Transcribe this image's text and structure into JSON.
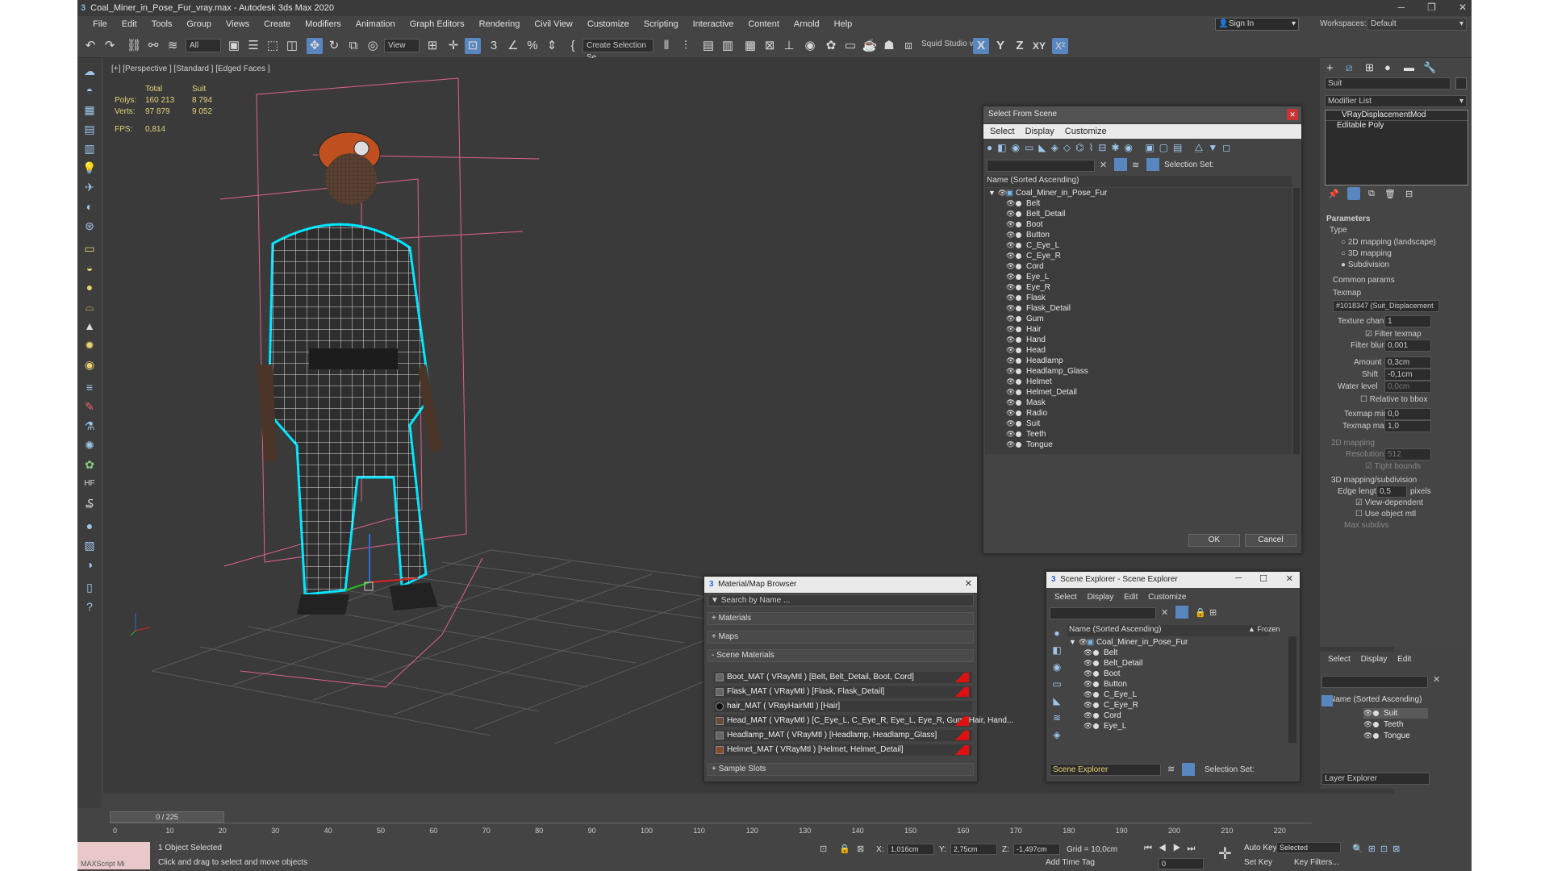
{
  "window": {
    "title": "Coal_Miner_in_Pose_Fur_vray.max - Autodesk 3ds Max 2020",
    "min": "─",
    "max": "❐",
    "close": "✕"
  },
  "menu": [
    "File",
    "Edit",
    "Tools",
    "Group",
    "Views",
    "Create",
    "Modifiers",
    "Animation",
    "Graph Editors",
    "Rendering",
    "Civil View",
    "Customize",
    "Scripting",
    "Interactive",
    "Content",
    "Arnold",
    "Help"
  ],
  "signin": "Sign In",
  "workspace": {
    "label": "Workspaces:",
    "value": "Default"
  },
  "toolbar": {
    "filter": "All",
    "ref_coord": "View",
    "create_selection": "Create Selection Se",
    "squid": "Squid Studio v",
    "axes": [
      "X",
      "Y",
      "Z",
      "XY"
    ]
  },
  "viewport": {
    "label": "[+] [Perspective ] [Standard ] [Edged Faces ]",
    "stats": {
      "h_total": "Total",
      "h_sel": "Suit",
      "polys_label": "Polys:",
      "polys_total": "160 213",
      "polys_sel": "8 794",
      "verts_label": "Verts:",
      "verts_total": "97 879",
      "verts_sel": "9 052",
      "fps_label": "FPS:",
      "fps": "0,814"
    }
  },
  "select_from_scene": {
    "title": "Select From Scene",
    "menu": [
      "Select",
      "Display",
      "Customize"
    ],
    "selection_set": "Selection Set:",
    "column": "Name (Sorted Ascending)",
    "root": "Coal_Miner_in_Pose_Fur",
    "items": [
      "Belt",
      "Belt_Detail",
      "Boot",
      "Button",
      "C_Eye_L",
      "C_Eye_R",
      "Cord",
      "Eye_L",
      "Eye_R",
      "Flask",
      "Flask_Detail",
      "Gum",
      "Hair",
      "Hand",
      "Head",
      "Headlamp",
      "Headlamp_Glass",
      "Helmet",
      "Helmet_Detail",
      "Mask",
      "Radio",
      "Suit",
      "Teeth",
      "Tongue"
    ],
    "ok": "OK",
    "cancel": "Cancel"
  },
  "material_browser": {
    "title": "Material/Map Browser",
    "search": "Search by Name ...",
    "sections": [
      "+ Materials",
      "+ Maps",
      "- Scene Materials",
      "+ Sample Slots"
    ],
    "materials": [
      "Boot_MAT  ( VRayMtl ) [Belt, Belt_Detail, Boot, Cord]",
      "Flask_MAT  ( VRayMtl ) [Flask, Flask_Detail]",
      "hair_MAT  ( VRayHairMtl ) [Hair]",
      "Head_MAT  ( VRayMtl ) [C_Eye_L, C_Eye_R, Eye_L, Eye_R, Gum, Hair, Hand...",
      "Headlamp_MAT  ( VRayMtl ) [Headlamp, Headlamp_Glass]",
      "Helmet_MAT  ( VRayMtl ) [Helmet, Helmet_Detail]"
    ]
  },
  "scene_explorer": {
    "title": "Scene Explorer - Scene Explorer",
    "menu": [
      "Select",
      "Display",
      "Edit",
      "Customize"
    ],
    "column": "Name (Sorted Ascending)",
    "frozen": "▲ Frozen",
    "root": "Coal_Miner_in_Pose_Fur",
    "items": [
      "Belt",
      "Belt_Detail",
      "Boot",
      "Button",
      "C_Eye_L",
      "C_Eye_R",
      "Cord",
      "Eye_L"
    ],
    "footer_name": "Scene Explorer",
    "selection_set": "Selection Set:"
  },
  "command_panel": {
    "object_name": "Suit",
    "modifier_list": "Modifier List",
    "stack": [
      "VRayDisplacementMod",
      "Editable Poly"
    ],
    "params_title": "Parameters",
    "type_label": "Type",
    "types": [
      "2D mapping (landscape)",
      "3D mapping",
      "Subdivision"
    ],
    "common": "Common params",
    "texmap_label": "Texmap",
    "texmap_value": "#1018347 (Suit_Displacement",
    "texture_chan_label": "Texture chan",
    "texture_chan": "1",
    "filter_texmap": "Filter texmap",
    "filter_blur_label": "Filter blur",
    "filter_blur": "0,001",
    "amount_label": "Amount",
    "amount": "0,3cm",
    "shift_label": "Shift",
    "shift": "-0,1cm",
    "water_label": "Water level",
    "water": "0,0cm",
    "relative": "Relative to bbox",
    "texmap_min_label": "Texmap min",
    "texmap_min": "0,0",
    "texmap_max_label": "Texmap max",
    "texmap_max": "1,0",
    "mapping2d": "2D mapping",
    "resolution_label": "Resolution",
    "resolution": "512",
    "tight": "Tight bounds",
    "mapping3d": "3D mapping/subdivision",
    "edge_label": "Edge length",
    "edge": "0,5",
    "pixels": "pixels",
    "view_dep": "View-dependent",
    "use_obj": "Use object mtl",
    "max_subdiv": "Max subdivs"
  },
  "layer_explorer": {
    "menu": [
      "Select",
      "Display",
      "Edit"
    ],
    "column": "Name (Sorted Ascending)",
    "items": [
      "Suit",
      "Teeth",
      "Tongue"
    ],
    "footer": "Layer Explorer"
  },
  "timeline": {
    "frame": "0 / 225",
    "ticks": [
      "0",
      "10",
      "20",
      "30",
      "40",
      "50",
      "60",
      "70",
      "80",
      "90",
      "100",
      "110",
      "120",
      "130",
      "140",
      "150",
      "160",
      "170",
      "180",
      "190",
      "200",
      "210",
      "220"
    ]
  },
  "status": {
    "script": "MAXScript Mi",
    "selected": "1 Object Selected",
    "hint": "Click and drag to select and move objects",
    "x_label": "X:",
    "x": "1,016cm",
    "y_label": "Y:",
    "y": "2,75cm",
    "z_label": "Z:",
    "z": "-1,497cm",
    "grid": "Grid = 10,0cm",
    "add_time_tag": "Add Time Tag",
    "auto_key": "Auto Key",
    "set_key": "Set Key",
    "selected_dd": "Selected",
    "key_filters": "Key Filters...",
    "frame_field": "0"
  },
  "colors": {
    "selection": "#00e5ff",
    "wire": "#ffffff",
    "bbox": "#e06090",
    "accent": "#5a86c0"
  }
}
